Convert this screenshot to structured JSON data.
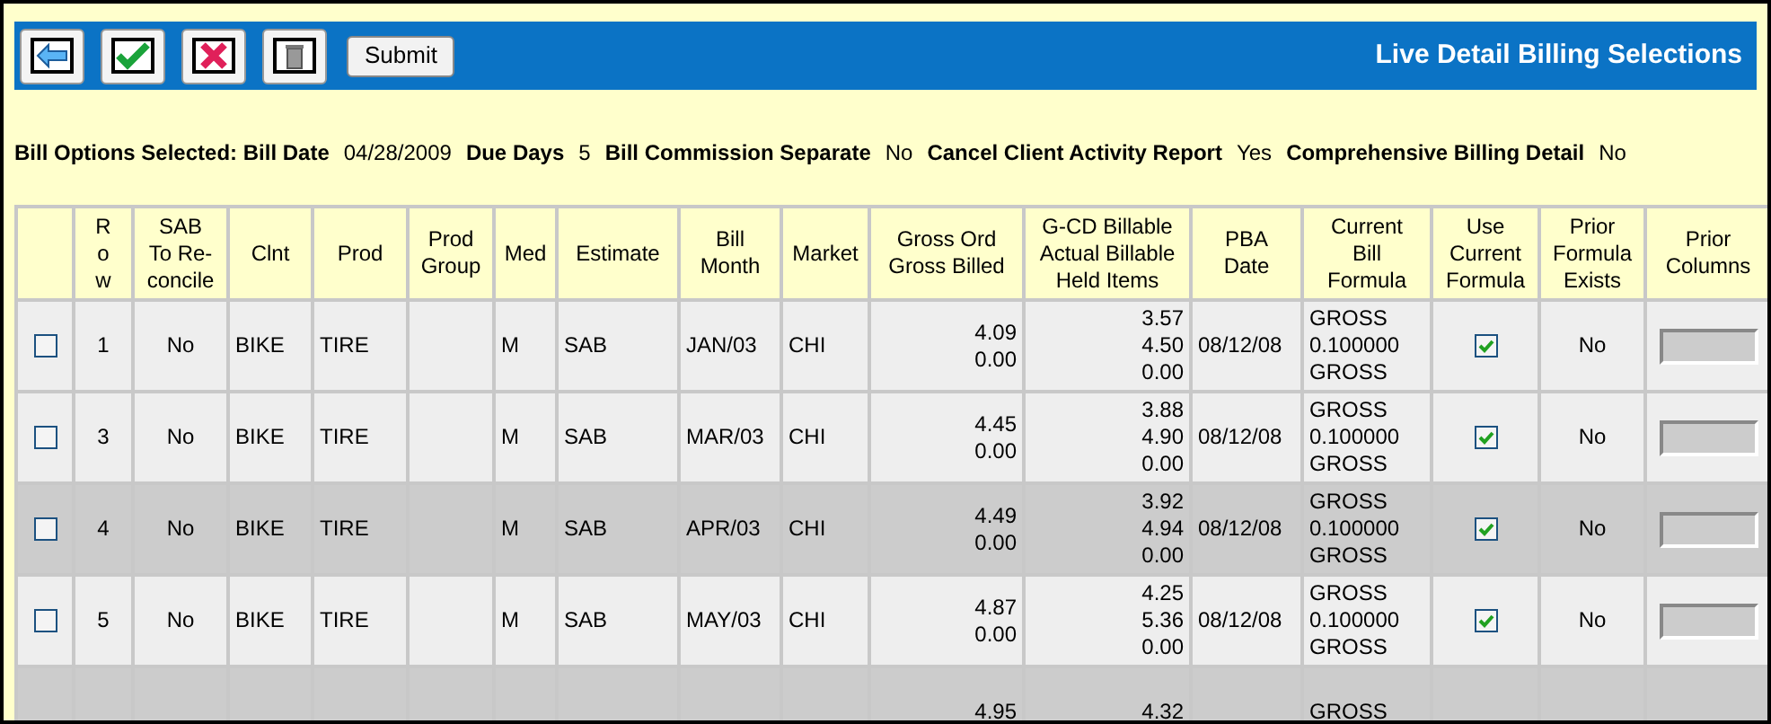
{
  "toolbar": {
    "buttons": [
      {
        "kind": "back"
      },
      {
        "kind": "accept"
      },
      {
        "kind": "cancel"
      },
      {
        "kind": "delete"
      }
    ],
    "submit": "Submit",
    "title": "Live Detail Billing Selections"
  },
  "options": [
    {
      "label": "Bill Options Selected: Bill Date",
      "value": "04/28/2009"
    },
    {
      "label": "Due Days",
      "value": "5"
    },
    {
      "label": "Bill Commission Separate",
      "value": "No"
    },
    {
      "label": "Cancel Client Activity Report",
      "value": "Yes"
    },
    {
      "label": "Comprehensive Billing Detail",
      "value": "No"
    }
  ],
  "table": {
    "columns": [
      [],
      [
        "R",
        "o",
        "w"
      ],
      [
        "SAB",
        "To Re-",
        "concile"
      ],
      [
        "Clnt"
      ],
      [
        "Prod"
      ],
      [
        "Prod",
        "Group"
      ],
      [
        "Med"
      ],
      [
        "Estimate"
      ],
      [
        "Bill",
        "Month"
      ],
      [
        "Market"
      ],
      [
        "Gross Ord",
        "Gross Billed"
      ],
      [
        "G-CD Billable",
        "Actual Billable",
        "Held Items"
      ],
      [
        "PBA",
        "Date"
      ],
      [
        "Current",
        "Bill",
        "Formula"
      ],
      [
        "Use",
        "Current",
        "Formula"
      ],
      [
        "Prior",
        "Formula",
        "Exists"
      ],
      [
        "Prior",
        "Columns"
      ]
    ],
    "rows": [
      {
        "selected": false,
        "row": "1",
        "reconcile": "No",
        "clnt": "BIKE",
        "prod": "TIRE",
        "prod_group": "",
        "med": "M",
        "estimate": "SAB",
        "bill_month": "JAN/03",
        "market": "CHI",
        "gross": [
          "4.09",
          "0.00"
        ],
        "billable": [
          "3.57",
          "4.50",
          "0.00"
        ],
        "pba_date": "08/12/08",
        "formula": [
          "GROSS",
          "0.100000",
          "GROSS"
        ],
        "use_current": true,
        "prior_exists": "No",
        "shaded": false
      },
      {
        "selected": false,
        "row": "3",
        "reconcile": "No",
        "clnt": "BIKE",
        "prod": "TIRE",
        "prod_group": "",
        "med": "M",
        "estimate": "SAB",
        "bill_month": "MAR/03",
        "market": "CHI",
        "gross": [
          "4.45",
          "0.00"
        ],
        "billable": [
          "3.88",
          "4.90",
          "0.00"
        ],
        "pba_date": "08/12/08",
        "formula": [
          "GROSS",
          "0.100000",
          "GROSS"
        ],
        "use_current": true,
        "prior_exists": "No",
        "shaded": false
      },
      {
        "selected": false,
        "row": "4",
        "reconcile": "No",
        "clnt": "BIKE",
        "prod": "TIRE",
        "prod_group": "",
        "med": "M",
        "estimate": "SAB",
        "bill_month": "APR/03",
        "market": "CHI",
        "gross": [
          "4.49",
          "0.00"
        ],
        "billable": [
          "3.92",
          "4.94",
          "0.00"
        ],
        "pba_date": "08/12/08",
        "formula": [
          "GROSS",
          "0.100000",
          "GROSS"
        ],
        "use_current": true,
        "prior_exists": "No",
        "shaded": true
      },
      {
        "selected": false,
        "row": "5",
        "reconcile": "No",
        "clnt": "BIKE",
        "prod": "TIRE",
        "prod_group": "",
        "med": "M",
        "estimate": "SAB",
        "bill_month": "MAY/03",
        "market": "CHI",
        "gross": [
          "4.87",
          "0.00"
        ],
        "billable": [
          "4.25",
          "5.36",
          "0.00"
        ],
        "pba_date": "08/12/08",
        "formula": [
          "GROSS",
          "0.100000",
          "GROSS"
        ],
        "use_current": true,
        "prior_exists": "No",
        "shaded": false
      },
      {
        "gross": [
          "4.95"
        ],
        "billable": [
          "4.32"
        ],
        "formula": [
          "GROSS"
        ],
        "shaded": true,
        "partial": true
      }
    ]
  }
}
